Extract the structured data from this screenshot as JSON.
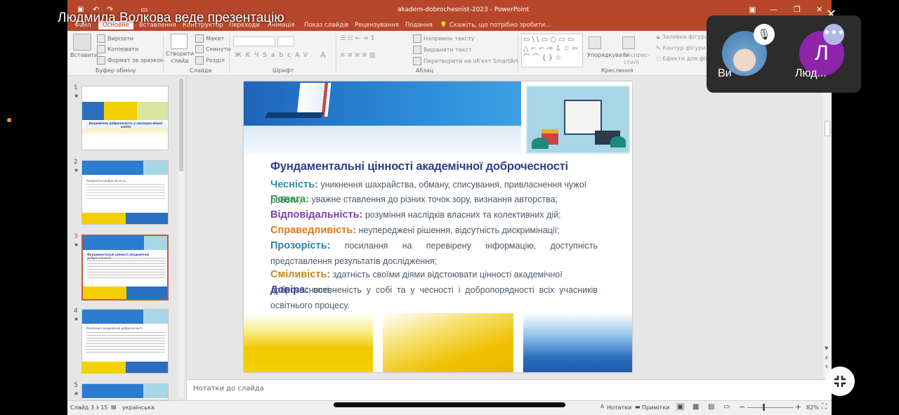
{
  "overlay": {
    "presenter_banner": "Людмила Волкова веде презентацію",
    "participants": [
      {
        "name": "Ви",
        "muted": true
      },
      {
        "name": "Люд...",
        "initial": "Л",
        "color": "#8e24aa"
      }
    ],
    "more_icon": "more-horizontal-icon",
    "exit_fullscreen_icon": "exit-fullscreen-icon"
  },
  "window": {
    "title": "akadem-dobrochesnist-2023 - PowerPoint",
    "help_text": "Скажіть, що потрібно зробити..."
  },
  "tabs": [
    "Файл",
    "Основне",
    "Вставлення",
    "Конструктор",
    "Переходи",
    "Анімація",
    "Показ слайдів",
    "Рецензування",
    "Подання"
  ],
  "ribbon": {
    "paste": "Вставити",
    "cut": "Вирізати",
    "copy": "Копіювати",
    "format_painter": "Формат за зразком",
    "clipboard_group": "Буфер обміну",
    "new_slide": "Створити слайд",
    "layout": "Макет",
    "reset": "Скинути",
    "section": "Розділ",
    "slides_group": "Слайди",
    "font_group": "Шрифт",
    "text_direction": "Напрямок тексту",
    "align_text": "Вирівняти текст",
    "smartart": "Перетворити на об'єкт SmartArt",
    "paragraph_group": "Абзац",
    "arrange": "Упорядкувати",
    "quick_styles": "Експрес-стилі",
    "shape_fill": "Заливка фігури",
    "shape_outline": "Контур фігури",
    "shape_effects": "Ефекти для фігур",
    "drawing_group": "Креслення"
  },
  "thumbnails": [
    {
      "number": "1",
      "title": "Академічна доброчесність у закладах вищої освіти"
    },
    {
      "number": "2",
      "title": "Академічна доброчесність"
    },
    {
      "number": "3",
      "title": "Фундаментальні цінності академічної доброчесності",
      "selected": true
    },
    {
      "number": "4",
      "title": "Реалізація академічної доброчесності"
    },
    {
      "number": "5",
      "title": ""
    }
  ],
  "slide": {
    "title": "Фундаментальні цінності академічної доброчесності",
    "items": [
      {
        "term": "Чесність:",
        "color": "#2f8fa8",
        "text": "уникнення шахрайства, обману, списування, привласнення чужої роботи;"
      },
      {
        "term": "Повага:",
        "color": "#2aa04a",
        "text": "уважне ставлення до різних точок зору, визнання авторства;"
      },
      {
        "term": "Відповідальність:",
        "color": "#7b3fa8",
        "text": "розуміння наслідків власних та колективних дій;"
      },
      {
        "term": "Справедливість:",
        "color": "#e07b1a",
        "text": "неупереджені рішення, відсутність дискримінації;"
      },
      {
        "term": "Прозорість:",
        "color": "#2f7fa8",
        "text": "посилання на перевірену інформацію, доступність представлення результатів дослідження;"
      },
      {
        "term": "Сміливість:",
        "color": "#c08a1a",
        "text": "здатність своїми діями відстоювати цінності академічної доброчесності;"
      },
      {
        "term": "Довіра:",
        "color": "#3a4a9a",
        "text": "впевненість у собі та у чесності і добропорядності всіх учасників освітнього процесу."
      }
    ]
  },
  "notes_placeholder": "Нотатки до слайда",
  "status": {
    "slide_counter": "Слайд 3 з 15",
    "language": "українська",
    "notes": "Нотатки",
    "comments": "Примітки",
    "zoom": "82%"
  }
}
